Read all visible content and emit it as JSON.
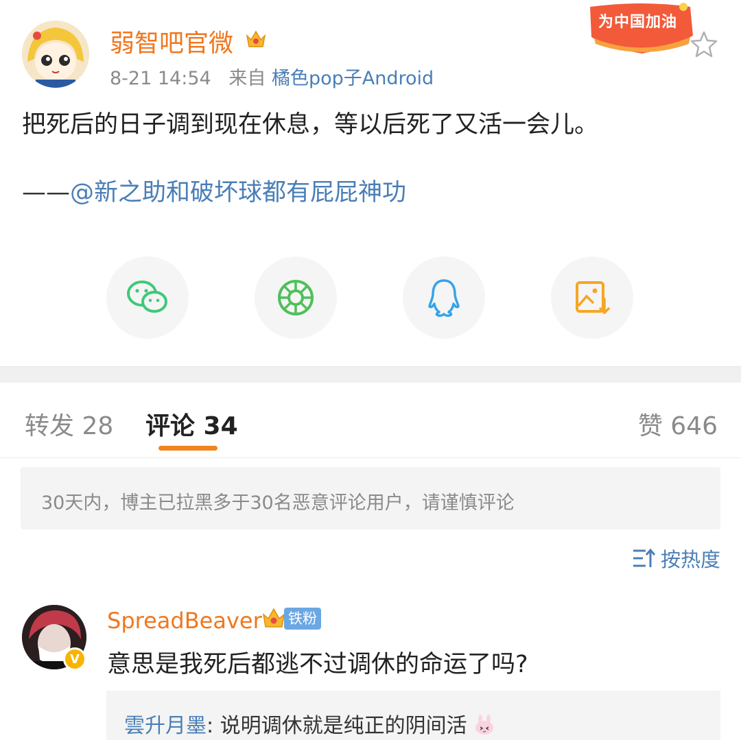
{
  "post": {
    "author": "弱智吧官微",
    "time": "8-21 14:54",
    "source_prefix": "来自",
    "source": "橘色pop子Android",
    "promo_badge": "为中国加油",
    "text": "把死后的日子调到现在休息，等以后死了又活一会儿。",
    "credit_dash": "——",
    "credit_mention": "@新之助和破坏球都有屁屁神功"
  },
  "share": [
    {
      "name": "wechat-icon",
      "color": "#3ec97a"
    },
    {
      "name": "moments-icon",
      "color": "#4fc05a"
    },
    {
      "name": "qq-icon",
      "color": "#35a4e8"
    },
    {
      "name": "save-image-icon",
      "color": "#f6a623"
    }
  ],
  "tabs": {
    "repost": "转发 28",
    "comments": "评论 34",
    "likes": "赞 646"
  },
  "notice": "30天内，博主已拉黑多于30名恶意评论用户，请谨慎评论",
  "sort": {
    "label": "按热度"
  },
  "comment": {
    "user": "SpreadBeaver",
    "fan_badge": "铁粉",
    "verified_mark": "V",
    "text": "意思是我死后都逃不过调休的命运了吗?",
    "reply_user": "雲升月墨",
    "reply_sep": ": ",
    "reply_text": "说明调休就是纯正的阴间活"
  },
  "colors": {
    "accent_orange": "#f0771e",
    "link_blue": "#4a7eb6",
    "tab_underline": "#f0841f"
  }
}
